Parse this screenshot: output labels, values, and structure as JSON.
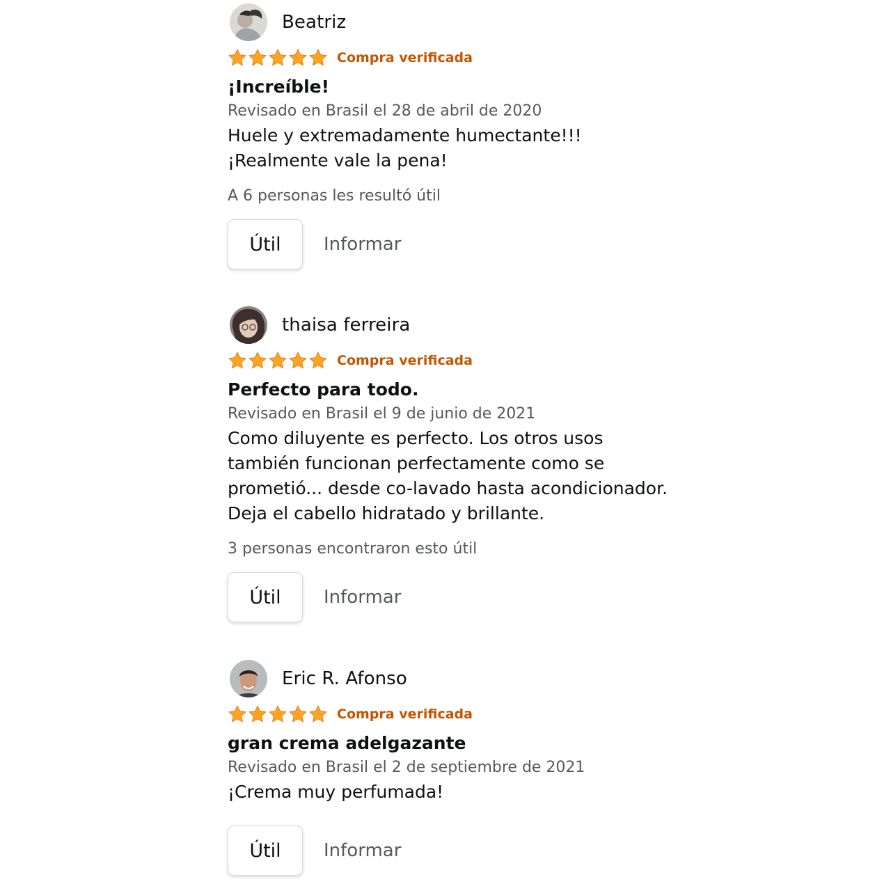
{
  "colors": {
    "star": "#ffa41c",
    "verified": "#c45500",
    "text": "#0f1111",
    "secondary": "#565959"
  },
  "reviews": [
    {
      "name": "Beatriz",
      "avatar_icon": "profile-photo",
      "rating": 5,
      "verified": "Compra verificada",
      "title": "¡Increíble!",
      "meta": "Revisado en Brasil el 28 de abril de 2020",
      "body": [
        "Huele y extremadamente humectante!!!",
        "¡Realmente vale la pena!"
      ],
      "helpful": "A 6 personas les resultó útil",
      "util_label": "Útil",
      "report_label": "Informar"
    },
    {
      "name": "thaisa ferreira",
      "avatar_icon": "profile-photo",
      "rating": 5,
      "verified": "Compra verificada",
      "title": "Perfecto para todo.",
      "meta": "Revisado en Brasil el 9 de junio de 2021",
      "body": [
        "Como diluyente es perfecto. Los otros usos",
        "también funcionan perfectamente como se",
        "prometió... desde co-lavado hasta acondicionador.",
        "Deja el cabello hidratado y brillante."
      ],
      "helpful": "3 personas encontraron esto útil",
      "util_label": "Útil",
      "report_label": "Informar"
    },
    {
      "name": "Eric R. Afonso",
      "avatar_icon": "profile-photo",
      "rating": 5,
      "verified": "Compra verificada",
      "title": "gran crema adelgazante",
      "meta": "Revisado en Brasil el 2 de septiembre de 2021",
      "body": [
        "¡Crema muy perfumada!"
      ],
      "helpful": "",
      "util_label": "Útil",
      "report_label": "Informar"
    }
  ]
}
